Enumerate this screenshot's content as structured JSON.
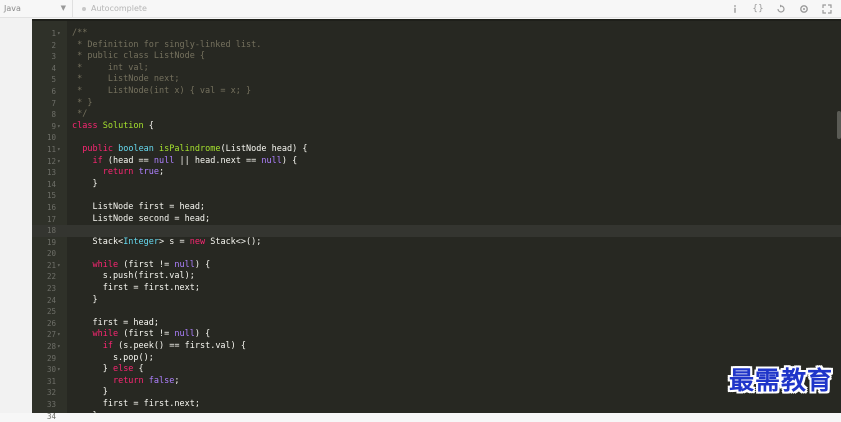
{
  "toolbar": {
    "language": "Java",
    "autocomplete_label": "Autocomplete",
    "icons": [
      "info-icon",
      "braces-icon",
      "reset-icon",
      "settings-icon",
      "fullscreen-icon"
    ]
  },
  "editor": {
    "lines": [
      {
        "n": "1",
        "fold": true,
        "tokens": [
          [
            "c",
            "/**"
          ]
        ]
      },
      {
        "n": "2",
        "tokens": [
          [
            "c",
            " * Definition for singly-linked list."
          ]
        ]
      },
      {
        "n": "3",
        "tokens": [
          [
            "c",
            " * public class ListNode {"
          ]
        ]
      },
      {
        "n": "4",
        "tokens": [
          [
            "c",
            " *     int val;"
          ]
        ]
      },
      {
        "n": "5",
        "tokens": [
          [
            "c",
            " *     ListNode next;"
          ]
        ]
      },
      {
        "n": "6",
        "tokens": [
          [
            "c",
            " *     ListNode(int x) { val = x; }"
          ]
        ]
      },
      {
        "n": "7",
        "tokens": [
          [
            "c",
            " * }"
          ]
        ]
      },
      {
        "n": "8",
        "tokens": [
          [
            "c",
            " */"
          ]
        ]
      },
      {
        "n": "9",
        "fold": true,
        "tokens": [
          [
            "k",
            "class"
          ],
          [
            "",
            " "
          ],
          [
            "cls",
            "Solution"
          ],
          [
            "",
            " {"
          ]
        ]
      },
      {
        "n": "10",
        "tokens": []
      },
      {
        "n": "11",
        "fold": true,
        "tokens": [
          [
            "",
            "  "
          ],
          [
            "k",
            "public"
          ],
          [
            "",
            " "
          ],
          [
            "s",
            "boolean"
          ],
          [
            "",
            " "
          ],
          [
            "cls",
            "isPalindrome"
          ],
          [
            "",
            "(ListNode head) {"
          ]
        ]
      },
      {
        "n": "12",
        "fold": true,
        "tokens": [
          [
            "",
            "    "
          ],
          [
            "k",
            "if"
          ],
          [
            "",
            " (head == "
          ],
          [
            "n",
            "null"
          ],
          [
            "",
            " || head.next == "
          ],
          [
            "n",
            "null"
          ],
          [
            "",
            ") {"
          ]
        ]
      },
      {
        "n": "13",
        "tokens": [
          [
            "",
            "      "
          ],
          [
            "k",
            "return"
          ],
          [
            "",
            " "
          ],
          [
            "n",
            "true"
          ],
          [
            "",
            ";"
          ]
        ]
      },
      {
        "n": "14",
        "tokens": [
          [
            "",
            "    }"
          ]
        ]
      },
      {
        "n": "15",
        "tokens": []
      },
      {
        "n": "16",
        "tokens": [
          [
            "",
            "    ListNode first = head;"
          ]
        ]
      },
      {
        "n": "17",
        "tokens": [
          [
            "",
            "    ListNode second = head;"
          ]
        ]
      },
      {
        "n": "18",
        "active": true,
        "tokens": []
      },
      {
        "n": "19",
        "tokens": [
          [
            "",
            "    Stack<"
          ],
          [
            "s",
            "Integer"
          ],
          [
            "",
            "> s = "
          ],
          [
            "k",
            "new"
          ],
          [
            "",
            " Stack<>();"
          ]
        ]
      },
      {
        "n": "20",
        "tokens": []
      },
      {
        "n": "21",
        "fold": true,
        "tokens": [
          [
            "",
            "    "
          ],
          [
            "k",
            "while"
          ],
          [
            "",
            " (first != "
          ],
          [
            "n",
            "null"
          ],
          [
            "",
            ") {"
          ]
        ]
      },
      {
        "n": "22",
        "tokens": [
          [
            "",
            "      s.push(first.val);"
          ]
        ]
      },
      {
        "n": "23",
        "tokens": [
          [
            "",
            "      first = first.next;"
          ]
        ]
      },
      {
        "n": "24",
        "tokens": [
          [
            "",
            "    }"
          ]
        ]
      },
      {
        "n": "25",
        "tokens": []
      },
      {
        "n": "26",
        "tokens": [
          [
            "",
            "    first = head;"
          ]
        ]
      },
      {
        "n": "27",
        "fold": true,
        "tokens": [
          [
            "",
            "    "
          ],
          [
            "k",
            "while"
          ],
          [
            "",
            " (first != "
          ],
          [
            "n",
            "null"
          ],
          [
            "",
            ") {"
          ]
        ]
      },
      {
        "n": "28",
        "fold": true,
        "tokens": [
          [
            "",
            "      "
          ],
          [
            "k",
            "if"
          ],
          [
            "",
            " (s.peek() == first.val) {"
          ]
        ]
      },
      {
        "n": "29",
        "tokens": [
          [
            "",
            "        s.pop();"
          ]
        ]
      },
      {
        "n": "30",
        "fold": true,
        "tokens": [
          [
            "",
            "      } "
          ],
          [
            "k",
            "else"
          ],
          [
            "",
            " {"
          ]
        ]
      },
      {
        "n": "31",
        "tokens": [
          [
            "",
            "        "
          ],
          [
            "k",
            "return"
          ],
          [
            "",
            " "
          ],
          [
            "n",
            "false"
          ],
          [
            "",
            ";"
          ]
        ]
      },
      {
        "n": "32",
        "tokens": [
          [
            "",
            "      }"
          ]
        ]
      },
      {
        "n": "33",
        "tokens": [
          [
            "",
            "      first = first.next;"
          ]
        ]
      },
      {
        "n": "34",
        "tokens": [
          [
            "",
            "    }"
          ]
        ]
      }
    ]
  },
  "watermark": "最需教育",
  "colors": {
    "editor_bg": "#272822",
    "comment": "#75715e",
    "keyword": "#f92672",
    "type": "#66d9ef",
    "literal": "#ae81ff",
    "identifier": "#a6e22e",
    "watermark": "#1f35c9"
  }
}
